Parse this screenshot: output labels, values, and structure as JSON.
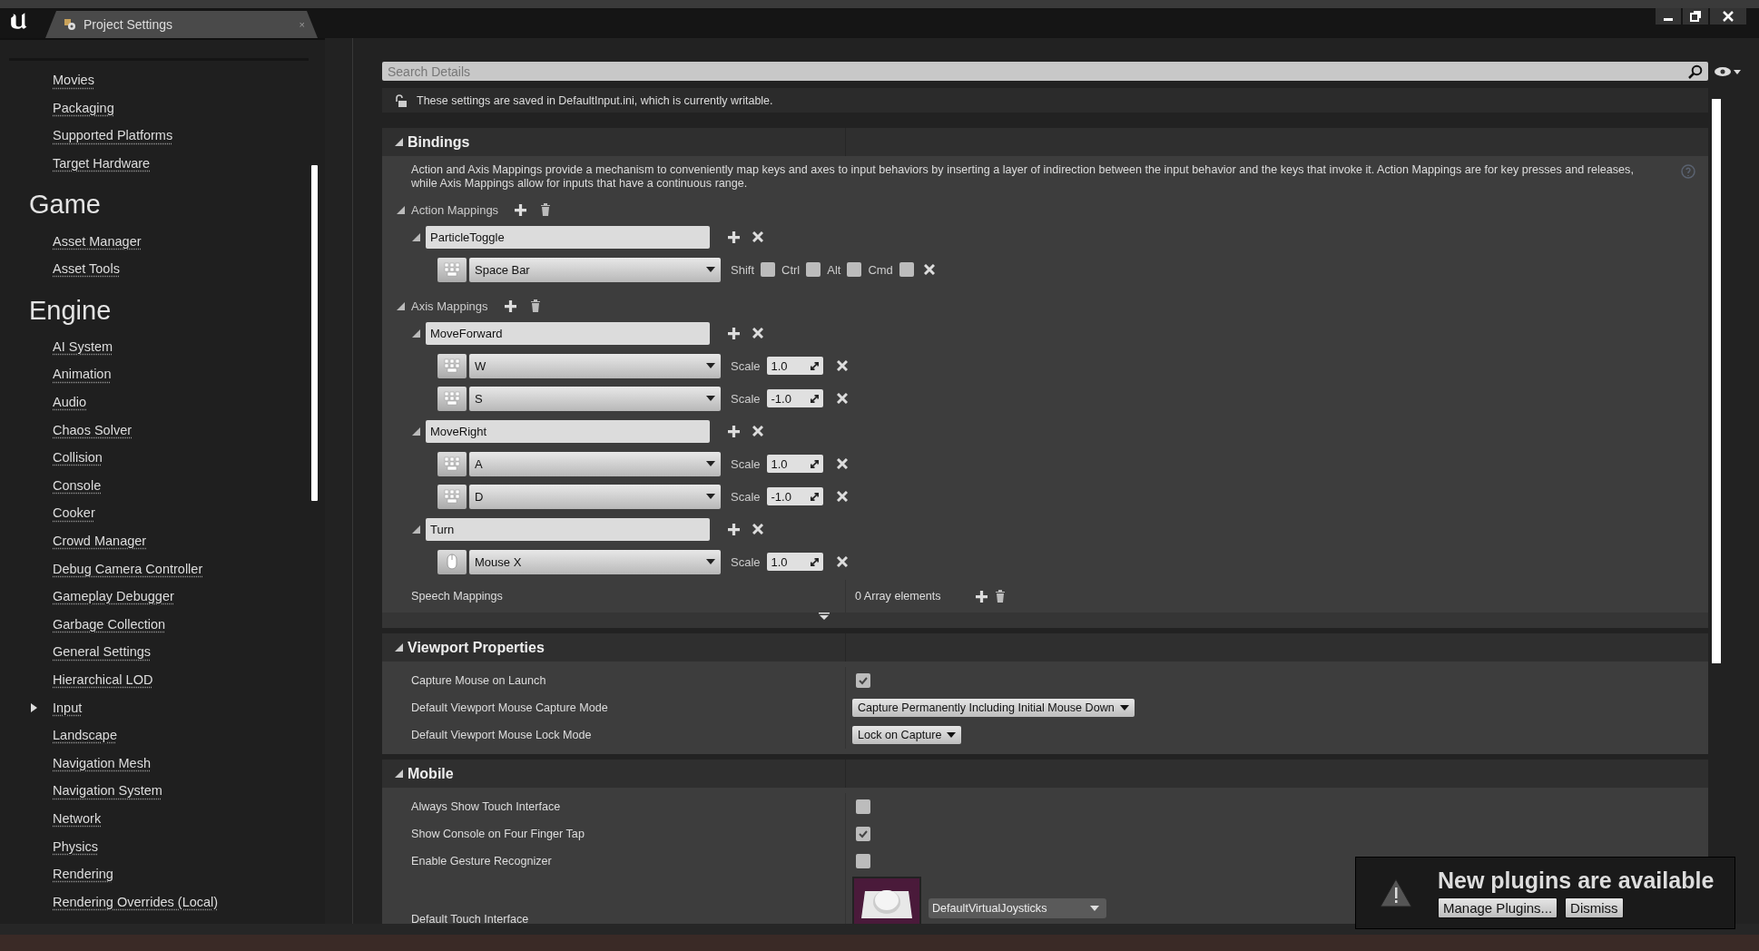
{
  "window": {
    "tab": {
      "title": "Project Settings",
      "close": "×"
    }
  },
  "sidebar": {
    "sections": [
      {
        "items": [
          {
            "label": "Movies",
            "kind": "link"
          },
          {
            "label": "Packaging",
            "kind": "link"
          },
          {
            "label": "Supported Platforms",
            "kind": "link"
          },
          {
            "label": "Target Hardware",
            "kind": "link"
          }
        ]
      },
      {
        "heading": "Game",
        "items": [
          {
            "label": "Asset Manager",
            "kind": "link"
          },
          {
            "label": "Asset Tools",
            "kind": "link"
          }
        ]
      },
      {
        "heading": "Engine",
        "items": [
          {
            "label": "AI System",
            "kind": "link"
          },
          {
            "label": "Animation",
            "kind": "link"
          },
          {
            "label": "Audio",
            "kind": "link"
          },
          {
            "label": "Chaos Solver",
            "kind": "link"
          },
          {
            "label": "Collision",
            "kind": "link"
          },
          {
            "label": "Console",
            "kind": "link"
          },
          {
            "label": "Cooker",
            "kind": "link"
          },
          {
            "label": "Crowd Manager",
            "kind": "link"
          },
          {
            "label": "Debug Camera Controller",
            "kind": "link"
          },
          {
            "label": "Gameplay Debugger",
            "kind": "link"
          },
          {
            "label": "Garbage Collection",
            "kind": "link"
          },
          {
            "label": "General Settings",
            "kind": "link"
          },
          {
            "label": "Hierarchical LOD",
            "kind": "link"
          },
          {
            "label": "Input",
            "kind": "expandable"
          },
          {
            "label": "Landscape",
            "kind": "link"
          },
          {
            "label": "Navigation Mesh",
            "kind": "link"
          },
          {
            "label": "Navigation System",
            "kind": "link"
          },
          {
            "label": "Network",
            "kind": "link"
          },
          {
            "label": "Physics",
            "kind": "link"
          },
          {
            "label": "Rendering",
            "kind": "link"
          },
          {
            "label": "Rendering Overrides (Local)",
            "kind": "link"
          }
        ]
      }
    ]
  },
  "details": {
    "search": {
      "placeholder": "Search Details"
    },
    "notice": "These settings are saved in DefaultInput.ini, which is currently writable.",
    "sections": [
      {
        "kind": "bindings",
        "title": "Bindings",
        "expanded": true,
        "description": "Action and Axis Mappings provide a mechanism to conveniently map keys and axes to input behaviors by inserting a layer of indirection between the input behavior and the keys that invoke it. Action Mappings are for key presses and releases, while Axis Mappings allow for inputs that have a continuous range.",
        "groups": [
          {
            "kind": "action",
            "label": "Action Mappings",
            "expanded": true,
            "mappings": [
              {
                "name": "ParticleToggle",
                "expanded": true,
                "keys": [
                  {
                    "key": "Space Bar",
                    "kind": "keyboard",
                    "modifiers": [
                      {
                        "label": "Shift",
                        "checked": false
                      },
                      {
                        "label": "Ctrl",
                        "checked": false
                      },
                      {
                        "label": "Alt",
                        "checked": false
                      },
                      {
                        "label": "Cmd",
                        "checked": false
                      }
                    ]
                  }
                ]
              }
            ]
          },
          {
            "kind": "axis",
            "label": "Axis Mappings",
            "expanded": true,
            "mappings": [
              {
                "name": "MoveForward",
                "expanded": true,
                "keys": [
                  {
                    "key": "W",
                    "kind": "keyboard",
                    "scale_label": "Scale",
                    "scale": "1.0"
                  },
                  {
                    "key": "S",
                    "kind": "keyboard",
                    "scale_label": "Scale",
                    "scale": "-1.0"
                  }
                ]
              },
              {
                "name": "MoveRight",
                "expanded": true,
                "keys": [
                  {
                    "key": "A",
                    "kind": "keyboard",
                    "scale_label": "Scale",
                    "scale": "1.0"
                  },
                  {
                    "key": "D",
                    "kind": "keyboard",
                    "scale_label": "Scale",
                    "scale": "-1.0"
                  }
                ]
              },
              {
                "name": "Turn",
                "expanded": true,
                "keys": [
                  {
                    "key": "Mouse X",
                    "kind": "mouse",
                    "scale_label": "Scale",
                    "scale": "1.0"
                  }
                ]
              }
            ]
          }
        ],
        "speech": {
          "label": "Speech Mappings",
          "value": "0 Array elements"
        }
      },
      {
        "kind": "properties",
        "title": "Viewport Properties",
        "expanded": true,
        "rows": [
          {
            "label": "Capture Mouse on Launch",
            "kind": "checkbox",
            "checked": true
          },
          {
            "label": "Default Viewport Mouse Capture Mode",
            "kind": "dropdown",
            "value": "Capture Permanently Including Initial Mouse Down"
          },
          {
            "label": "Default Viewport Mouse Lock Mode",
            "kind": "dropdown",
            "value": "Lock on Capture"
          }
        ]
      },
      {
        "kind": "properties",
        "title": "Mobile",
        "expanded": true,
        "rows": [
          {
            "label": "Always Show Touch Interface",
            "kind": "checkbox",
            "checked": false
          },
          {
            "label": "Show Console on Four Finger Tap",
            "kind": "checkbox",
            "checked": true
          },
          {
            "label": "Enable Gesture Recognizer",
            "kind": "checkbox",
            "checked": false
          },
          {
            "label": "Default Touch Interface",
            "kind": "asset",
            "value": "DefaultVirtualJoysticks"
          }
        ]
      }
    ]
  },
  "notification": {
    "title": "New plugins are available",
    "buttons": [
      "Manage Plugins...",
      "Dismiss"
    ]
  }
}
